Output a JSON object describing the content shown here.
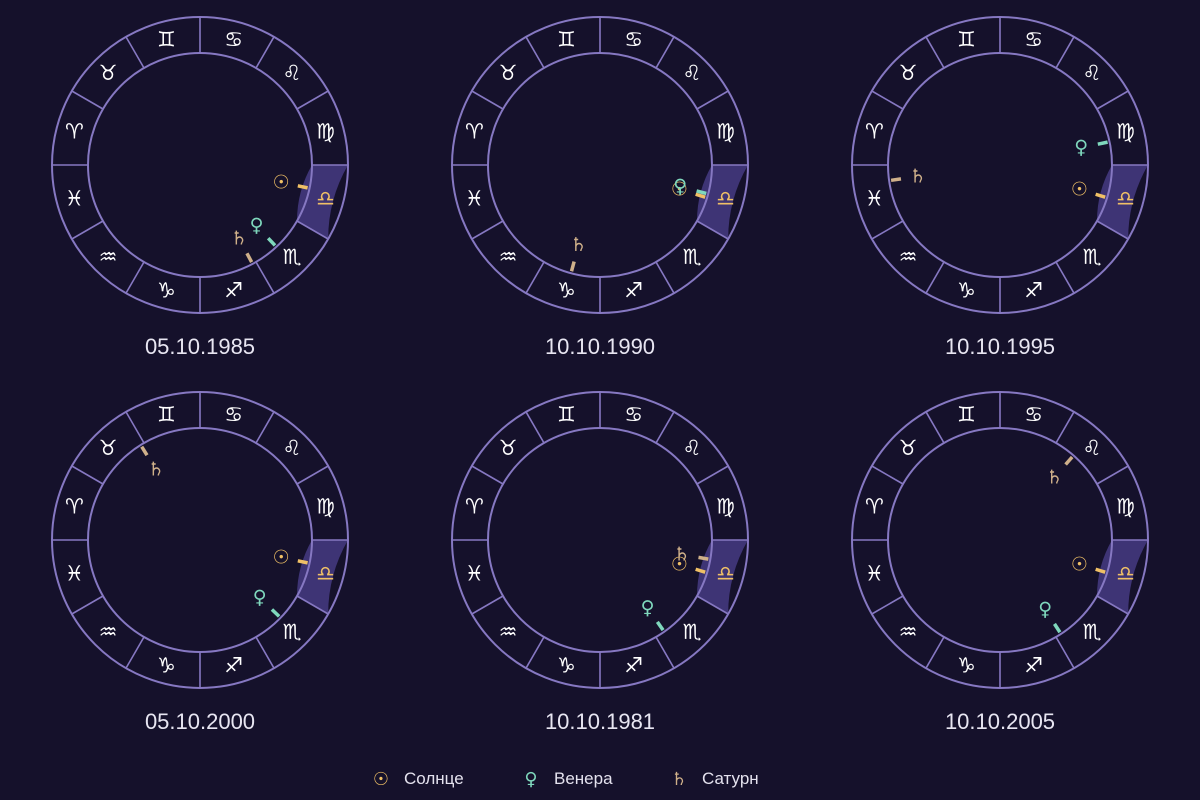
{
  "colors": {
    "background": "#15112b",
    "wheel_stroke": "#8678c2",
    "highlight_fill": "#3e3475",
    "sign_glyph": "#ffffff",
    "date_text": "#e8e6f2",
    "sun": "#f0c066",
    "venus": "#7fd8bd",
    "saturn": "#cfb08a"
  },
  "signs": [
    {
      "name": "Aries",
      "glyph": "♈"
    },
    {
      "name": "Taurus",
      "glyph": "♉"
    },
    {
      "name": "Gemini",
      "glyph": "♊"
    },
    {
      "name": "Cancer",
      "glyph": "♋"
    },
    {
      "name": "Leo",
      "glyph": "♌"
    },
    {
      "name": "Virgo",
      "glyph": "♍"
    },
    {
      "name": "Libra",
      "glyph": "♎"
    },
    {
      "name": "Scorpio",
      "glyph": "♏"
    },
    {
      "name": "Sagittarius",
      "glyph": "♐"
    },
    {
      "name": "Capricorn",
      "glyph": "♑"
    },
    {
      "name": "Aquarius",
      "glyph": "♒"
    },
    {
      "name": "Pisces",
      "glyph": "♓"
    }
  ],
  "highlighted_sign": "Libra",
  "planets": {
    "sun": {
      "label": "Солнце",
      "glyph": "☉"
    },
    "venus": {
      "label": "Венера",
      "glyph": "♀"
    },
    "saturn": {
      "label": "Сатурн",
      "glyph": "♄"
    }
  },
  "charts": [
    {
      "date": "05.10.1985",
      "positions": {
        "sun": 192,
        "venus": 227,
        "saturn": 242
      }
    },
    {
      "date": "10.10.1990",
      "positions": {
        "sun": 197,
        "venus": 195,
        "saturn": 285
      }
    },
    {
      "date": "10.10.1995",
      "positions": {
        "sun": 197,
        "venus": 168,
        "saturn": 352
      }
    },
    {
      "date": "05.10.2000",
      "positions": {
        "sun": 192,
        "venus": 224,
        "saturn": 58
      }
    },
    {
      "date": "10.10.1981",
      "positions": {
        "sun": 197,
        "venus": 235,
        "saturn": 190
      }
    },
    {
      "date": "10.10.2005",
      "positions": {
        "sun": 197,
        "venus": 237,
        "saturn": 131
      }
    }
  ],
  "legend": [
    {
      "key": "sun",
      "label": "Солнце"
    },
    {
      "key": "venus",
      "label": "Венера"
    },
    {
      "key": "saturn",
      "label": "Сатурн"
    }
  ]
}
